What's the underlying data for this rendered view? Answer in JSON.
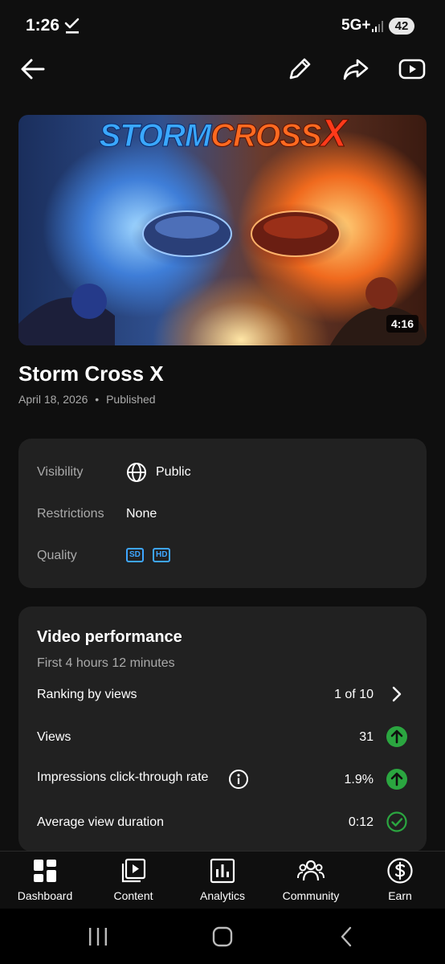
{
  "status_bar": {
    "time": "1:26",
    "network": "5G+",
    "battery": "42"
  },
  "top_bar": {
    "icons": [
      "back-arrow-icon",
      "pencil-icon",
      "share-icon",
      "youtube-icon"
    ]
  },
  "thumbnail": {
    "overlay_title_part1": "STORM",
    "overlay_title_part2": "CROSS",
    "overlay_title_part3": "X",
    "duration": "4:16"
  },
  "video": {
    "title": "Storm Cross X",
    "date": "April 18, 2026",
    "status": "Published"
  },
  "details": {
    "visibility_label": "Visibility",
    "visibility_value": "Public",
    "restrictions_label": "Restrictions",
    "restrictions_value": "None",
    "quality_label": "Quality",
    "quality_badges": [
      "SD",
      "HD"
    ],
    "accent_color": "#3ea6ff"
  },
  "performance": {
    "title": "Video performance",
    "subtitle": "First 4 hours 12 minutes",
    "rows": [
      {
        "label": "Ranking by views",
        "value": "1 of 10",
        "icon": "chevron-right-icon"
      },
      {
        "label": "Views",
        "value": "31",
        "icon": "arrow-up-icon"
      },
      {
        "label": "Impressions click-through rate",
        "value": "1.9%",
        "icon": "arrow-up-icon"
      },
      {
        "label": "Average view duration",
        "value": "0:12",
        "icon": "check-circle-icon"
      }
    ],
    "positive_color": "#2ba640"
  },
  "bottom_nav": {
    "items": [
      {
        "label": "Dashboard",
        "icon": "dashboard-icon"
      },
      {
        "label": "Content",
        "icon": "content-icon"
      },
      {
        "label": "Analytics",
        "icon": "analytics-icon"
      },
      {
        "label": "Community",
        "icon": "community-icon"
      },
      {
        "label": "Earn",
        "icon": "dollar-icon"
      }
    ]
  }
}
